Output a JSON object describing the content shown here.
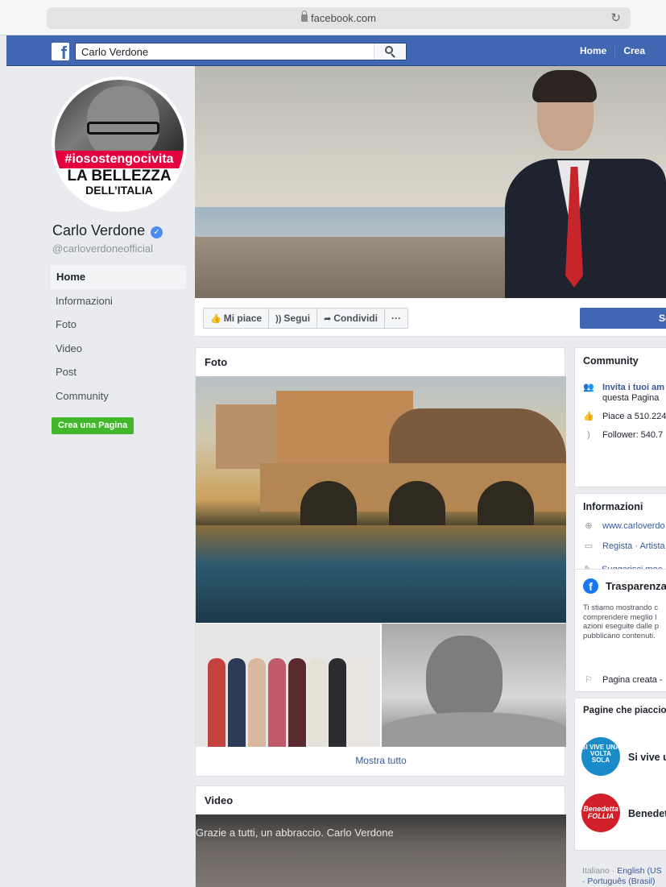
{
  "browser": {
    "url": "facebook.com"
  },
  "topbar": {
    "search_value": "Carlo Verdone",
    "nav_home": "Home",
    "nav_create": "Crea"
  },
  "profile": {
    "hashtag": "#iosostengocivita",
    "line1": "LA BELLEZZA",
    "line2": "DELL’ITALIA",
    "name": "Carlo Verdone",
    "handle": "@carloverdoneofficial"
  },
  "sidebar": {
    "items": [
      {
        "label": "Home"
      },
      {
        "label": "Informazioni"
      },
      {
        "label": "Foto"
      },
      {
        "label": "Video"
      },
      {
        "label": "Post"
      },
      {
        "label": "Community"
      }
    ],
    "create_page": "Crea una Pagina"
  },
  "actions": {
    "like": "Mi piace",
    "follow": "Segui",
    "share": "Condividi",
    "more": "···",
    "send": "So"
  },
  "foto": {
    "title": "Foto",
    "show_all": "Mostra tutto"
  },
  "video": {
    "title": "Video",
    "caption": "Grazie a tutti, un abbraccio. Carlo Verdone"
  },
  "community": {
    "title": "Community",
    "invite": "Invita i tuoi am",
    "invite_sub": "questa Pagina",
    "likes": "Piace a 510.224",
    "followers": "Follower: 540.7"
  },
  "info": {
    "title": "Informazioni",
    "website": "www.carloverdo",
    "category": "Regista · Artista",
    "suggest": "Suggerisci moc"
  },
  "transparency": {
    "title": "Trasparenza",
    "desc": [
      "Ti stiamo mostrando c",
      "comprendere meglio l",
      "azioni eseguite dalle p",
      "pubblicano contenuti."
    ],
    "created": "Pagina creata -"
  },
  "liked_pages": {
    "title": "Pagine che piaccion",
    "page1": "Si vive u",
    "page1_logo": "SI VIVE UNA VOLTA SOLA",
    "page2": "Benedet",
    "page2_logo": "Benedetta FOLLIA"
  },
  "footer": {
    "line1_lang": "Italiano · ",
    "line1_link": "English (US",
    "line2": "· Português (Brasil)"
  },
  "colors": {
    "fb_blue": "#4267b2",
    "link": "#385898",
    "green": "#42b72a",
    "verified": "#4c8cf5"
  }
}
